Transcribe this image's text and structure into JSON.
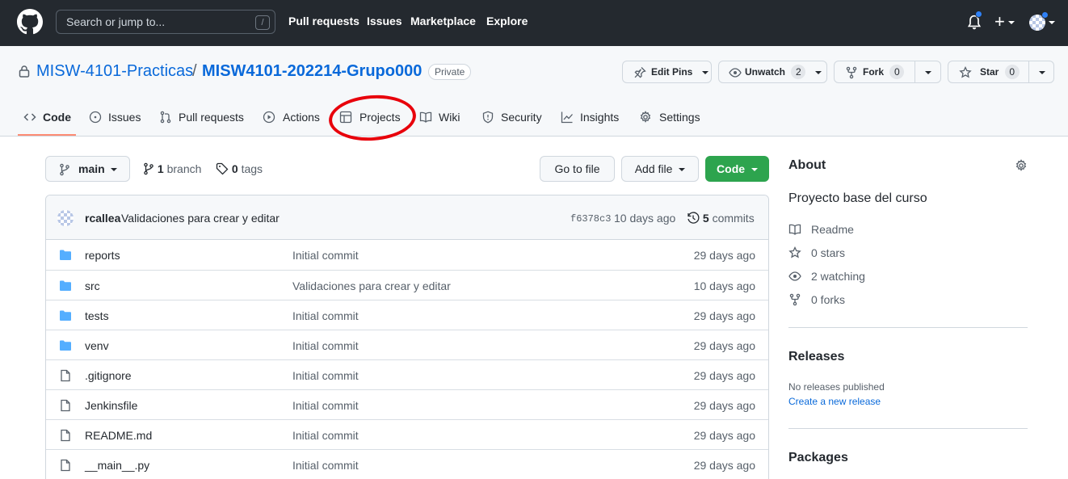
{
  "header": {
    "search_placeholder": "Search or jump to...",
    "search_shortcut": "/",
    "nav": [
      "Pull requests",
      "Issues",
      "Marketplace",
      "Explore"
    ]
  },
  "repo": {
    "owner": "MISW-4101-Practicas",
    "separator": "/",
    "name": "MISW4101-202214-Grupo000",
    "visibility": "Private",
    "edit_pins_label": "Edit Pins",
    "unwatch_label": "Unwatch",
    "watch_count": "2",
    "fork_label": "Fork",
    "fork_count": "0",
    "star_label": "Star",
    "star_count": "0"
  },
  "tabs": [
    "Code",
    "Issues",
    "Pull requests",
    "Actions",
    "Projects",
    "Wiki",
    "Security",
    "Insights",
    "Settings"
  ],
  "toolbar": {
    "branch": "main",
    "branch_count": "1",
    "branch_label": "branch",
    "tag_count": "0",
    "tag_label": "tags",
    "go_to_file": "Go to file",
    "add_file": "Add file",
    "code": "Code"
  },
  "commit": {
    "author": "rcallea",
    "message": "Validaciones para crear y editar",
    "sha": "f6378c3",
    "age": "10 days ago",
    "commit_count": "5",
    "commit_label": "commits"
  },
  "files": [
    {
      "name": "reports",
      "type": "dir",
      "message": "Initial commit",
      "age": "29 days ago"
    },
    {
      "name": "src",
      "type": "dir",
      "message": "Validaciones para crear y editar",
      "age": "10 days ago"
    },
    {
      "name": "tests",
      "type": "dir",
      "message": "Initial commit",
      "age": "29 days ago"
    },
    {
      "name": "venv",
      "type": "dir",
      "message": "Initial commit",
      "age": "29 days ago"
    },
    {
      "name": ".gitignore",
      "type": "file",
      "message": "Initial commit",
      "age": "29 days ago"
    },
    {
      "name": "Jenkinsfile",
      "type": "file",
      "message": "Initial commit",
      "age": "29 days ago"
    },
    {
      "name": "README.md",
      "type": "file",
      "message": "Initial commit",
      "age": "29 days ago"
    },
    {
      "name": "__main__.py",
      "type": "file",
      "message": "Initial commit",
      "age": "29 days ago"
    }
  ],
  "sidebar": {
    "about_title": "About",
    "description": "Proyecto base del curso",
    "readme": "Readme",
    "stars": "0 stars",
    "watching": "2 watching",
    "forks": "0 forks",
    "releases_title": "Releases",
    "no_releases": "No releases published",
    "create_release": "Create a new release",
    "packages_title": "Packages"
  },
  "colors": {
    "header_bg": "#24292f",
    "link": "#0969da",
    "code_button": "#2da44e",
    "active_tab_underline": "#fd8c73",
    "annotation_circle": "#e8000b",
    "folder": "#54aeff"
  }
}
